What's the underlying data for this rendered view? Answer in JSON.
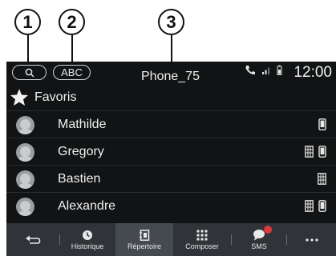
{
  "callouts": [
    "1",
    "2",
    "3"
  ],
  "header": {
    "search_icon": "search-icon",
    "abc_label": "ABC",
    "phone_name": "Phone_75",
    "time": "12:00",
    "status_icons": [
      "phone-call-icon",
      "signal-icon",
      "battery-icon"
    ]
  },
  "favorites": {
    "label": "Favoris",
    "icon": "star-icon"
  },
  "contacts": [
    {
      "name": "Mathilde",
      "icons": [
        "mobile-phone-icon"
      ]
    },
    {
      "name": "Gregory",
      "icons": [
        "office-phone-icon",
        "mobile-phone-icon"
      ]
    },
    {
      "name": "Bastien",
      "icons": [
        "office-phone-icon"
      ]
    },
    {
      "name": "Alexandre",
      "icons": [
        "office-phone-icon",
        "mobile-phone-icon"
      ]
    }
  ],
  "navbar": {
    "items": [
      {
        "label": "",
        "icon": "back-arrow-icon"
      },
      {
        "label": "Historique",
        "icon": "clock-icon"
      },
      {
        "label": "Répertoire",
        "icon": "contacts-book-icon",
        "active": true
      },
      {
        "label": "Composer",
        "icon": "keypad-icon"
      },
      {
        "label": "SMS",
        "icon": "sms-bubble-icon",
        "notification": true
      },
      {
        "label": "",
        "icon": "more-icon"
      }
    ]
  },
  "colors": {
    "screen_bg": "#111315",
    "navbar_bg": "#303338",
    "active_tab": "#454a51",
    "notification": "#e0383e"
  }
}
